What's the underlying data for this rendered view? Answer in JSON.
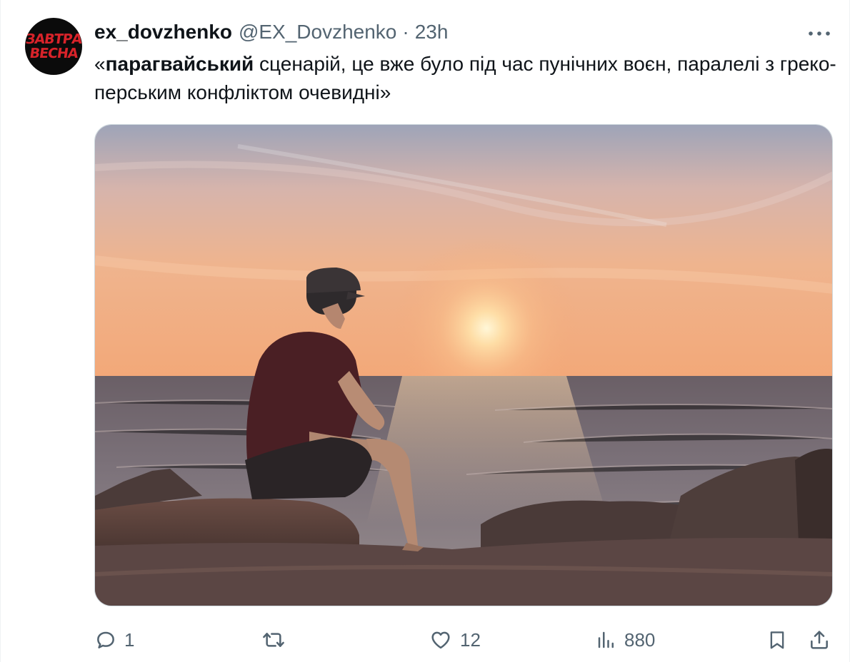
{
  "tweet": {
    "author": {
      "display_name": "ex_dovzhenko",
      "handle": "@EX_Dovzhenko",
      "avatar_text_line1": "ЗАВТРА",
      "avatar_text_line2": "ВЕСНА"
    },
    "separator": "·",
    "time": "23h",
    "text_open_quote": "«",
    "text_bold": "парагвайський",
    "text_rest": " сценарій, це вже було під час пунічних воєн, паралелі з греко-перським конфліктом очевидні»",
    "media": {
      "description_icon": "photo-man-on-rocks-sunset-sea"
    },
    "metrics": {
      "replies": "1",
      "reposts": "",
      "likes": "12",
      "views": "880"
    }
  },
  "colors": {
    "text_primary": "#0f1419",
    "text_secondary": "#536471",
    "border": "#cfd9de",
    "avatar_bg": "#0b0b0b",
    "avatar_text": "#d8232a"
  },
  "icons": {
    "more": "more-horizontal-icon",
    "reply": "reply-icon",
    "repost": "repost-icon",
    "like": "like-icon",
    "views": "views-icon",
    "bookmark": "bookmark-icon",
    "share": "share-icon"
  }
}
